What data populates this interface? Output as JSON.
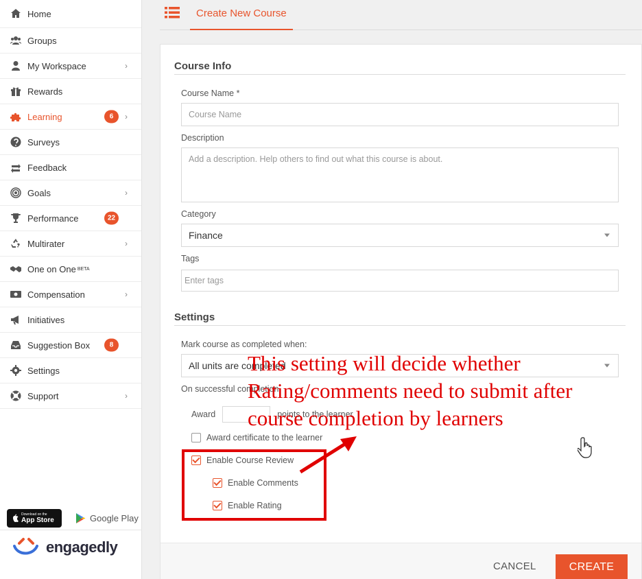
{
  "sidebar": {
    "items": [
      {
        "label": "Home",
        "icon": "home-icon"
      },
      {
        "label": "Groups",
        "icon": "users-icon"
      },
      {
        "label": "My Workspace",
        "icon": "user-icon",
        "chevron": true
      },
      {
        "label": "Rewards",
        "icon": "gift-icon"
      },
      {
        "label": "Learning",
        "icon": "puzzle-icon",
        "badge": "6",
        "chevron": true,
        "active": true
      },
      {
        "label": "Surveys",
        "icon": "question-icon"
      },
      {
        "label": "Feedback",
        "icon": "exchange-icon"
      },
      {
        "label": "Goals",
        "icon": "target-icon",
        "chevron": true
      },
      {
        "label": "Performance",
        "icon": "trophy-icon",
        "badge": "22"
      },
      {
        "label": "Multirater",
        "icon": "recycle-icon",
        "chevron": true
      },
      {
        "label": "One on One",
        "sup": "BETA",
        "icon": "handshake-icon"
      },
      {
        "label": "Compensation",
        "icon": "money-icon",
        "chevron": true
      },
      {
        "label": "Initiatives",
        "icon": "bullhorn-icon"
      },
      {
        "label": "Suggestion Box",
        "icon": "inbox-icon",
        "badge": "8"
      },
      {
        "label": "Settings",
        "icon": "gear-icon"
      },
      {
        "label": "Support",
        "icon": "lifebuoy-icon",
        "chevron": true
      }
    ],
    "app_store": {
      "small": "Download on the",
      "big": "App Store"
    },
    "google_play": "Google Play",
    "logo_text": "engagedly"
  },
  "tabs": {
    "active_label": "Create New Course"
  },
  "form": {
    "course_info_title": "Course Info",
    "course_name_label": "Course Name *",
    "course_name_placeholder": "Course Name",
    "description_label": "Description",
    "description_placeholder": "Add a description. Help others to find out what this course is about.",
    "category_label": "Category",
    "category_value": "Finance",
    "tags_label": "Tags",
    "tags_placeholder": "Enter tags",
    "settings_title": "Settings",
    "mark_completed_label": "Mark course as completed when:",
    "mark_completed_value": "All units are completed",
    "on_success_label": "On successful completion",
    "award_label": "Award",
    "award_suffix": "points to the learner",
    "certificate_label": "Award certificate to the learner",
    "certificate_checked": false,
    "review_label": "Enable Course Review",
    "review_checked": true,
    "comments_label": "Enable Comments",
    "comments_checked": true,
    "rating_label": "Enable Rating",
    "rating_checked": true
  },
  "actions": {
    "cancel": "CANCEL",
    "create": "CREATE"
  },
  "annotation": {
    "text": "This setting will  decide whether\nRating/comments need to submit after\ncourse completion by learners",
    "color": "#e00000"
  },
  "colors": {
    "accent": "#e8542c",
    "annotation": "#e00000"
  }
}
